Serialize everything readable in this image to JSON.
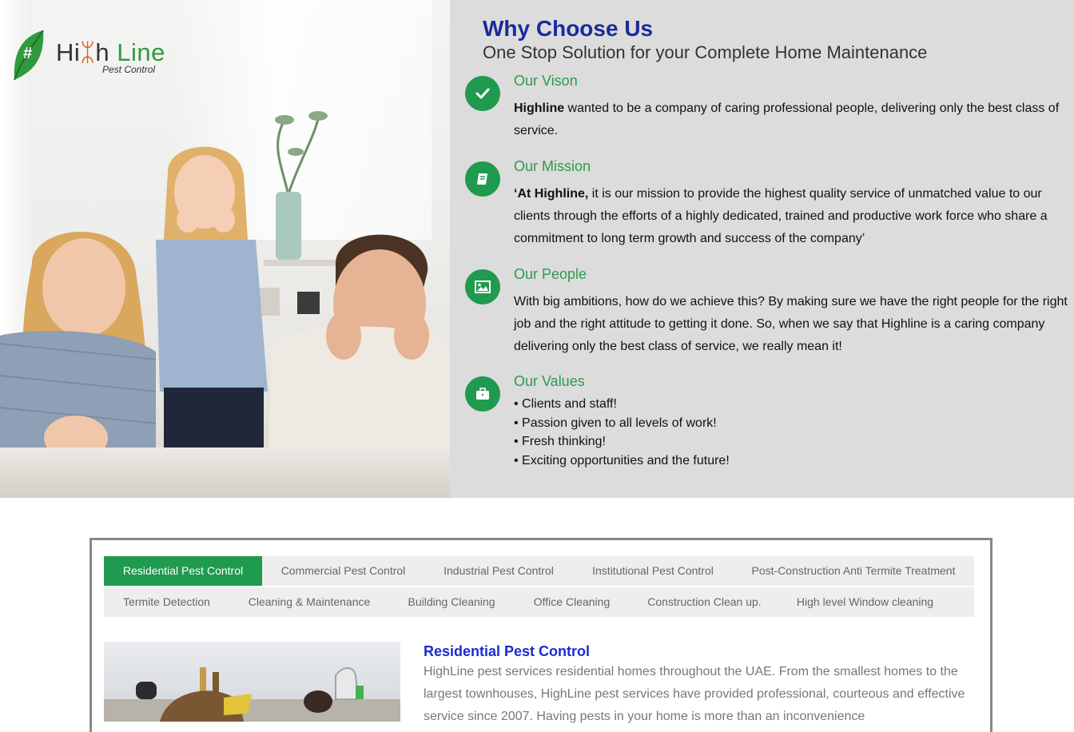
{
  "brand": {
    "name_part1": "Hi",
    "name_part2": "h",
    "name_part3": "Line",
    "tagline": "Pest Control",
    "accent_green": "#1f9a4f",
    "heading_blue": "#1a2b9c"
  },
  "why": {
    "title": "Why Choose Us",
    "subtitle": "One Stop Solution for your Complete Home Maintenance"
  },
  "features": [
    {
      "title": "Our Vison",
      "icon": "check-icon",
      "lead": "Highline",
      "text": " wanted to be a company of caring professional people, delivering only the best class of service."
    },
    {
      "title": "Our Mission",
      "icon": "book-icon",
      "lead": "‘At Highline,",
      "text": " it is our mission to provide the highest quality service of unmatched value to our clients through the efforts of a highly dedicated, trained and productive work force who share a commitment to long term growth and success of the company’"
    },
    {
      "title": "Our People",
      "icon": "image-icon",
      "text": "With big ambitions, how do we achieve this? By making sure we have the right people for the right job and the right attitude to getting it done. So, when we say that Highline is a caring company delivering only the best class of service, we really mean it!"
    },
    {
      "title": "Our Values",
      "icon": "briefcase-icon",
      "items": [
        "Clients and staff!",
        "Passion given to all levels of work!",
        "Fresh thinking!",
        "Exciting opportunities and the future!"
      ]
    }
  ],
  "services": {
    "tabs_row1": [
      "Residential Pest Control",
      "Commercial Pest Control",
      "Industrial Pest Control",
      "Institutional Pest Control",
      "Post-Construction Anti Termite Treatment"
    ],
    "tabs_row2": [
      "Termite Detection",
      "Cleaning & Maintenance",
      "Building Cleaning",
      "Office Cleaning",
      "Construction Clean up.",
      "High level Window cleaning"
    ],
    "active_tab": "Residential Pest Control",
    "content_title": "Residential Pest Control",
    "content_text": "HighLine pest services residential homes throughout the UAE. From the smallest homes to the largest townhouses, HighLine pest services have provided professional, courteous and effective service since 2007. Having pests in your home is more than an inconvenience"
  }
}
